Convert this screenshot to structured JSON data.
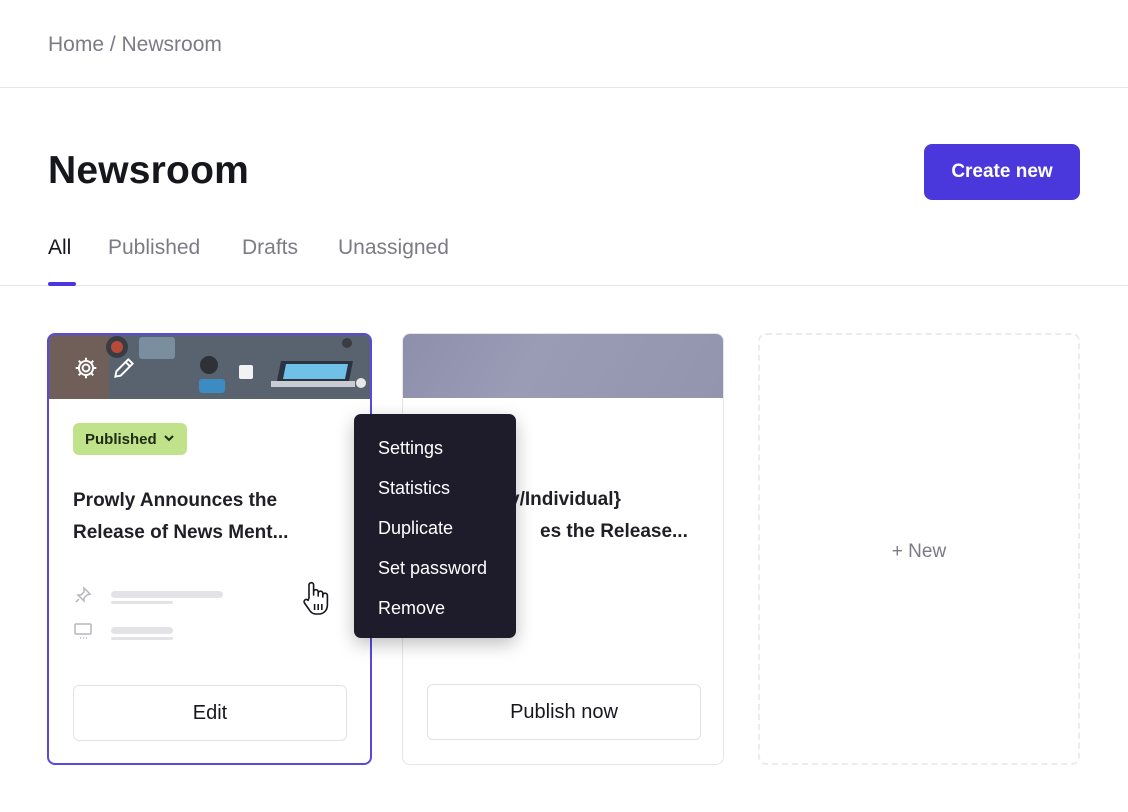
{
  "breadcrumb": "Home / Newsroom",
  "page": {
    "title": "Newsroom",
    "create_button": "Create new"
  },
  "tabs": [
    {
      "label": "All",
      "active": true
    },
    {
      "label": "Published",
      "active": false
    },
    {
      "label": "Drafts",
      "active": false
    },
    {
      "label": "Unassigned",
      "active": false
    }
  ],
  "cards": [
    {
      "status": "Published",
      "title_line1": "Prowly Announces the",
      "title_line2": "Release of News Ment...",
      "button": "Edit"
    },
    {
      "title_line1": "y/Individual}",
      "title_line2": "es the Release...",
      "button": "Publish now"
    }
  ],
  "new_card_label": "+ New",
  "context_menu": [
    "Settings",
    "Statistics",
    "Duplicate",
    "Set password",
    "Remove"
  ],
  "colors": {
    "accent": "#4b38dd",
    "badge": "#bfe28a",
    "menu_bg": "#1e1c2a"
  },
  "icons": [
    "gear-icon",
    "pencil-icon",
    "chevron-down-icon",
    "pin-icon",
    "monitor-icon",
    "hand-cursor-icon"
  ]
}
